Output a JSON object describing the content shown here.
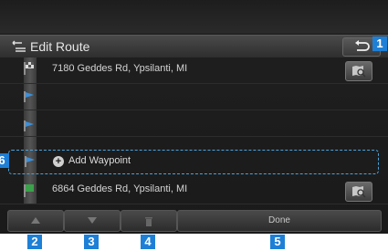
{
  "header": {
    "title": "Edit Route",
    "back_icon": "back-arrow-icon",
    "route_icon": "route-edit-icon"
  },
  "route": {
    "start": {
      "address": "7180 Geddes Rd, Ypsilanti, MI",
      "flag_icon": "start-flag-icon",
      "map_icon": "map-search-icon"
    },
    "waypoint_flags": [
      "waypoint-flag-icon",
      "waypoint-flag-icon",
      "waypoint-flag-icon"
    ],
    "add_waypoint": {
      "label": "Add Waypoint",
      "icon": "plus-circle-icon"
    },
    "destination": {
      "address": "6864 Geddes Rd, Ypsilanti, MI",
      "flag_icon": "destination-flag-icon",
      "map_icon": "map-search-icon"
    }
  },
  "bottom_bar": {
    "move_up_icon": "move-up-icon",
    "move_down_icon": "move-down-icon",
    "delete_icon": "trash-icon",
    "done_label": "Done"
  },
  "callouts": [
    "1",
    "2",
    "3",
    "4",
    "5",
    "6"
  ],
  "colors": {
    "accent": "#1e7fd6",
    "highlight": "#4aa3dc",
    "flag_blue": "#3d8fd6",
    "flag_green": "#3aa24a"
  }
}
